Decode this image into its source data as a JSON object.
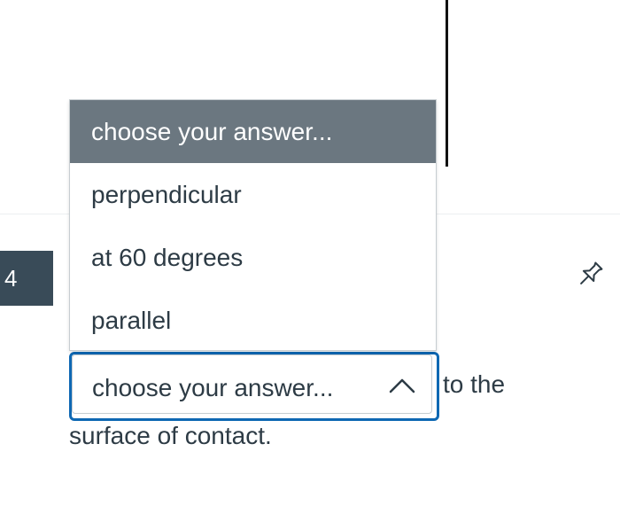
{
  "question": {
    "number": "4",
    "after_select_text": "to the",
    "line_two_text": "surface of contact."
  },
  "select": {
    "current_value": "choose your answer...",
    "options": [
      {
        "label": "choose your answer...",
        "highlighted": true
      },
      {
        "label": "perpendicular",
        "highlighted": false
      },
      {
        "label": "at 60 degrees",
        "highlighted": false
      },
      {
        "label": "parallel",
        "highlighted": false
      }
    ]
  },
  "icons": {
    "pin": "pin-icon",
    "chevron": "chevron-up-icon"
  },
  "colors": {
    "focus_border": "#0e68b3",
    "highlight_bg": "#6b7780",
    "number_badge_bg": "#394b58",
    "text": "#2d3b45"
  }
}
